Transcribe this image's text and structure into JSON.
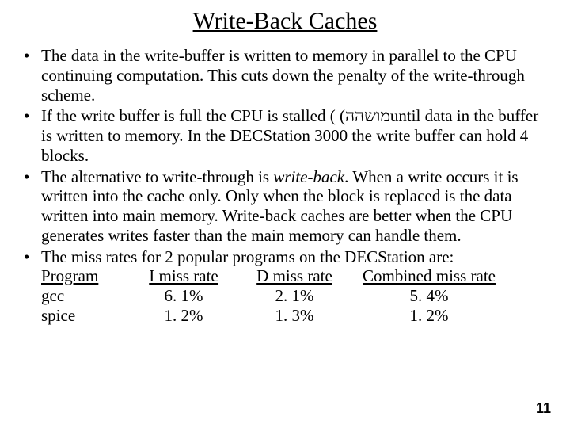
{
  "title": "Write-Back Caches",
  "bullets": [
    "The data in the write-buffer is written to memory in parallel to the CPU continuing computation. This cuts down the penalty of the write-through scheme.",
    "If the write buffer is full the CPU is stalled ( (מושההuntil data in the buffer is written to memory. In the DECStation 3000 the write buffer can hold 4 blocks.",
    "",
    "The miss rates for 2 popular programs on the DECStation are:"
  ],
  "bullet3": {
    "pre": "The alternative to write-through is ",
    "em": "write-back",
    "post": ". When a write occurs it is written into the cache only. Only when the block is replaced is the data written into main memory. Write-back caches are better when the CPU generates writes faster than the main memory can handle them."
  },
  "table": {
    "headers": [
      "Program",
      "I miss rate",
      "D miss rate",
      "Combined miss rate"
    ],
    "rows": [
      [
        "gcc",
        "6. 1%",
        "2. 1%",
        "5. 4%"
      ],
      [
        "spice",
        "1. 2%",
        "1. 3%",
        "1. 2%"
      ]
    ]
  },
  "page_number": "11"
}
